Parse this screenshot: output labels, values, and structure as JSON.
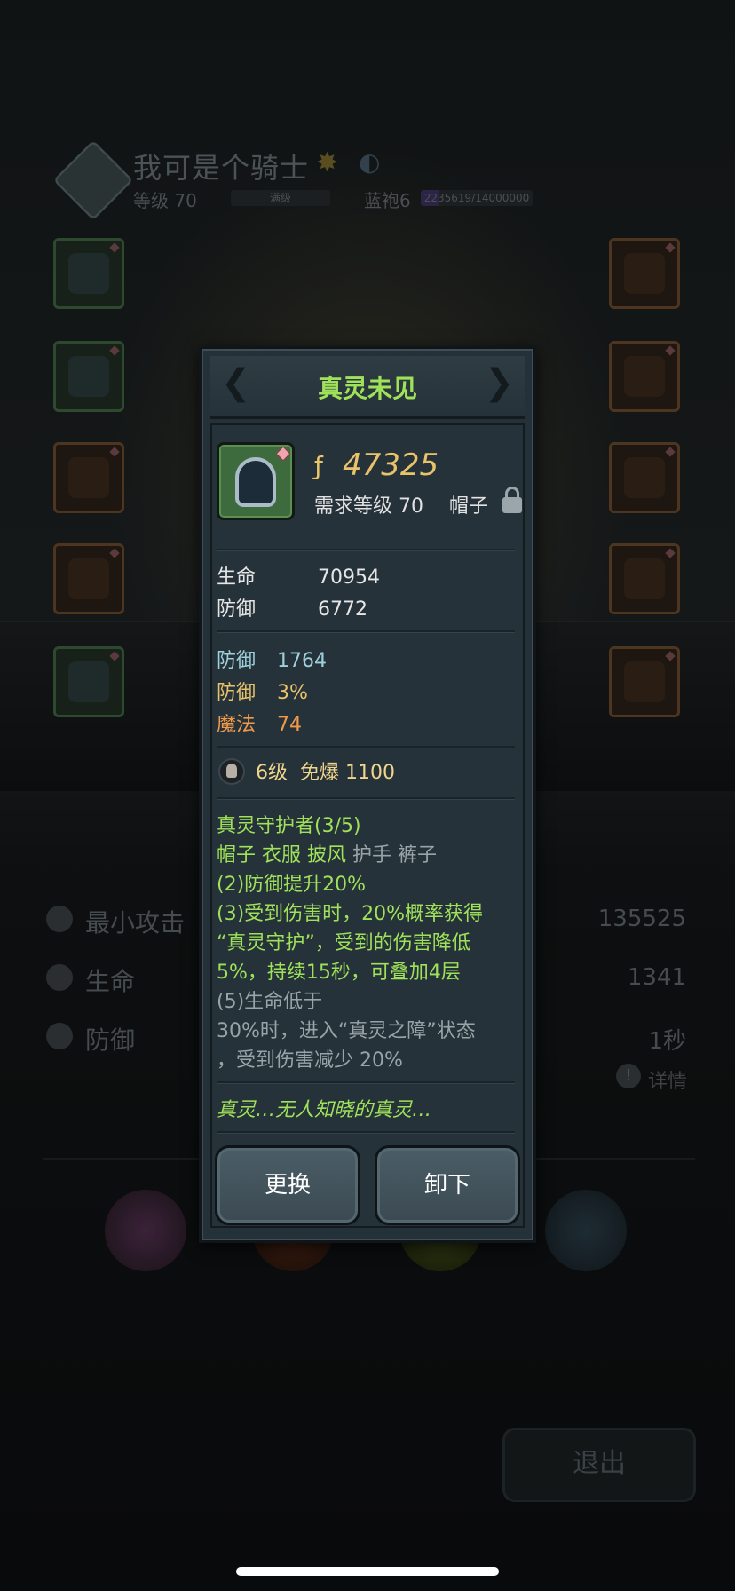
{
  "hero": {
    "name": "我可是个骑士",
    "level_label": "等级 70",
    "level_bar_text": "满级",
    "robe_label": "蓝袍6",
    "exp_text": "2235619/14000000",
    "exp_fraction": 0.16
  },
  "background_stats": [
    {
      "label": "最小攻击",
      "value": "135525"
    },
    {
      "label": "生命",
      "value": "1341"
    },
    {
      "label": "防御",
      "value": "1秒"
    }
  ],
  "details_label": "详情",
  "exit_label": "退出",
  "item": {
    "title": "真灵未见",
    "power": "47325",
    "requirement": "需求等级 70",
    "slot_type": "帽子",
    "base_stats": [
      {
        "k": "生命",
        "v": "70954"
      },
      {
        "k": "防御",
        "v": "6772"
      }
    ],
    "extra_stats": [
      {
        "k": "防御",
        "v": "1764",
        "color": "#9fd0dc"
      },
      {
        "k": "防御",
        "v": "3%",
        "color": "#e8c36a"
      },
      {
        "k": "魔法",
        "v": "74",
        "color": "#f09a4a"
      }
    ],
    "gem": {
      "level": "6级",
      "bonus": "免爆 1100"
    },
    "set": {
      "title": "真灵守护者(3/5)",
      "pieces_owned": "帽子 衣服 披风",
      "pieces_missing": "护手 裤子",
      "lines": [
        {
          "text": "(2)防御提升20%",
          "active": true
        },
        {
          "text": "(3)受到伤害时，20%概率获得",
          "active": true
        },
        {
          "text": "“真灵守护”，受到的伤害降低",
          "active": true
        },
        {
          "text": "5%，持续15秒，可叠加4层",
          "active": true
        },
        {
          "text": "(5)生命低于",
          "active": false
        },
        {
          "text": "30%时，进入“真灵之障”状态",
          "active": false
        },
        {
          "text": "，受到伤害减少 20%",
          "active": false
        }
      ]
    },
    "flavor": "真灵…无人知晓的真灵…",
    "buttons": {
      "replace": "更换",
      "unequip": "卸下"
    }
  }
}
